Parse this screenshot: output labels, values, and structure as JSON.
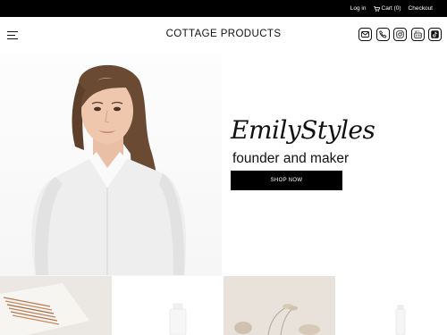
{
  "topbar": {
    "login_label": "Log in",
    "cart_label": "Cart (0)",
    "checkout_label": "Checkout"
  },
  "header": {
    "brand": "COTTAGE PRODUCTS",
    "menu_icon": "hamburger-menu-icon",
    "social_icons": [
      "mail-icon",
      "phone-icon",
      "instagram-icon",
      "youtube-icon",
      "tiktok-icon"
    ]
  },
  "hero": {
    "signature": "EmilyStyles",
    "tagline": "founder and maker",
    "cta_label": "SHOP NOW"
  },
  "product_tiles": [
    "straws-linen-image",
    "white-bottle-image",
    "dried-flowers-image",
    "tall-bottle-image"
  ],
  "colors": {
    "topbar_bg": "#000000",
    "button_bg": "#000000",
    "page_bg": "#ffffff"
  }
}
